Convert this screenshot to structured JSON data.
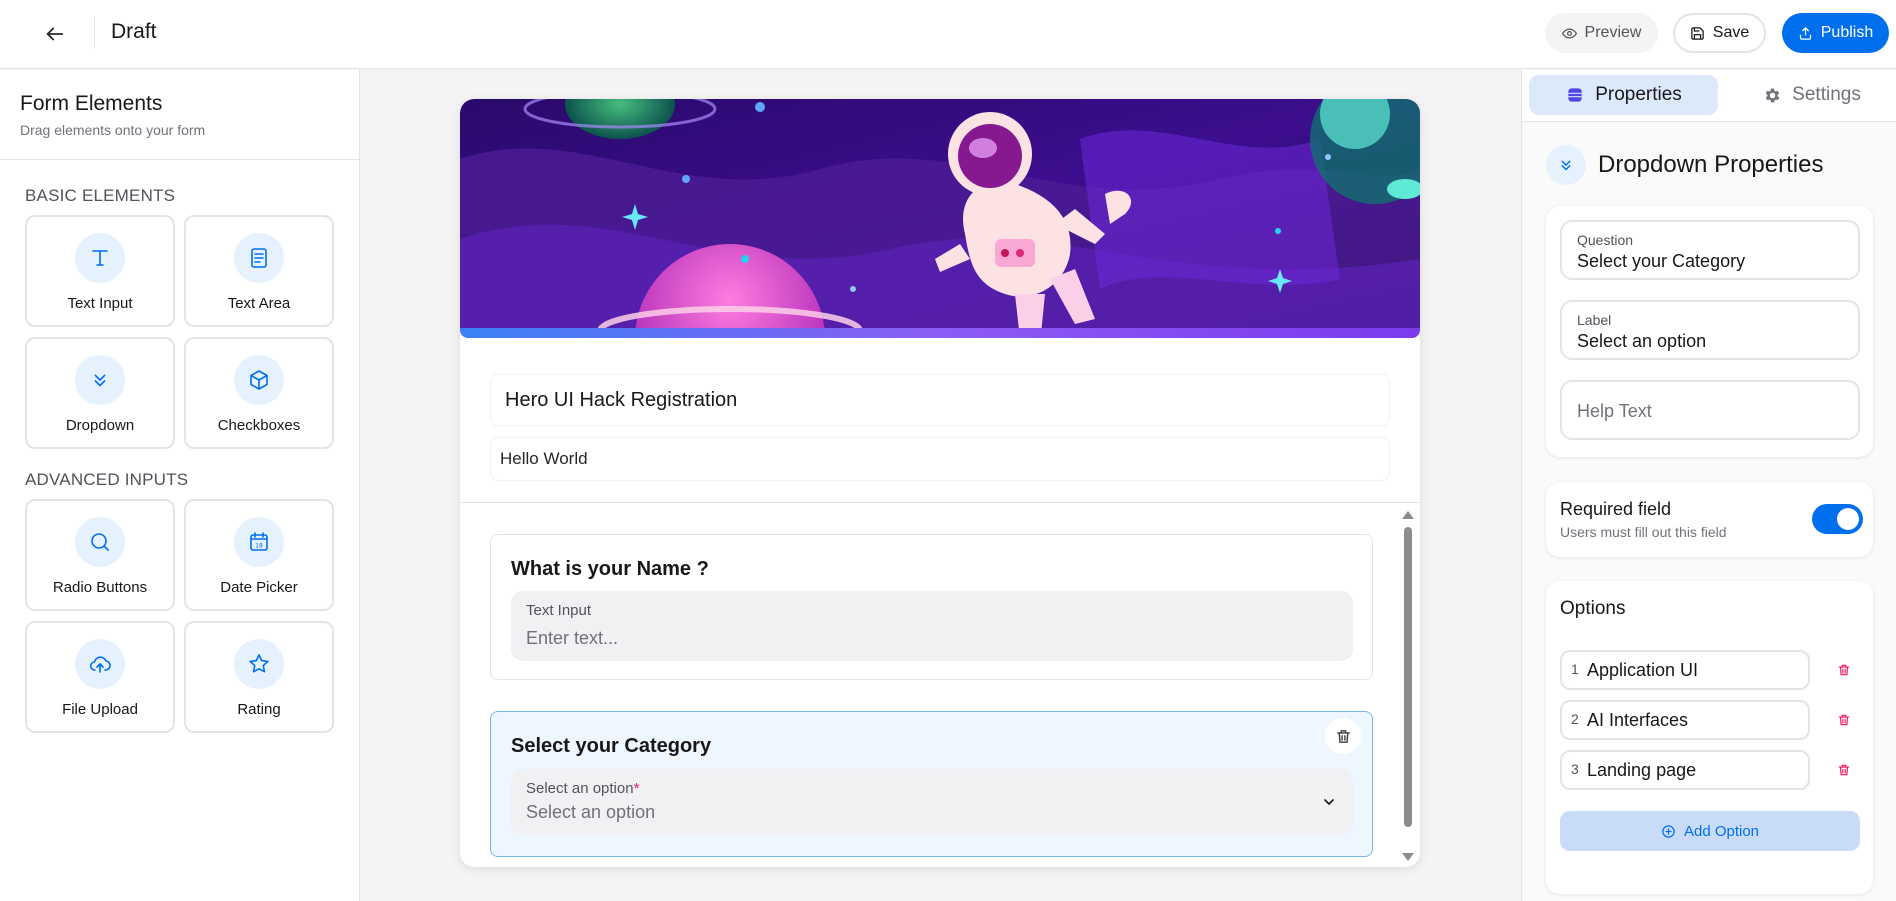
{
  "header": {
    "title": "Draft",
    "preview_label": "Preview",
    "save_label": "Save",
    "publish_label": "Publish"
  },
  "sidebar": {
    "title": "Form Elements",
    "subtitle": "Drag elements onto your form",
    "basic_title": "BASIC ELEMENTS",
    "advanced_title": "ADVANCED INPUTS",
    "basic": [
      {
        "label": "Text Input",
        "icon": "text-icon"
      },
      {
        "label": "Text Area",
        "icon": "text-area-icon"
      },
      {
        "label": "Dropdown",
        "icon": "chevron-double-down-icon"
      },
      {
        "label": "Checkboxes",
        "icon": "box-icon"
      }
    ],
    "advanced": [
      {
        "label": "Radio Buttons",
        "icon": "radio-icon"
      },
      {
        "label": "Date Picker",
        "icon": "calendar-icon"
      },
      {
        "label": "File Upload",
        "icon": "cloud-upload-icon"
      },
      {
        "label": "Rating",
        "icon": "star-icon"
      }
    ]
  },
  "form": {
    "title": "Hero UI Hack Registration",
    "description": "Hello World",
    "questions": [
      {
        "title": "What is your Name ?",
        "field_label": "Text Input",
        "placeholder": "Enter text..."
      },
      {
        "title": "Select your Category",
        "field_label": "Select an option",
        "required_mark": "*",
        "placeholder": "Select an option"
      }
    ]
  },
  "panel": {
    "tabs": {
      "properties": "Properties",
      "settings": "Settings"
    },
    "heading": "Dropdown Properties",
    "question_label": "Question",
    "question_value": "Select your Category",
    "label_label": "Label",
    "label_value": "Select an option",
    "help_placeholder": "Help Text",
    "required_title": "Required field",
    "required_sub": "Users must fill out this field",
    "required_on": true,
    "options_title": "Options",
    "options": [
      {
        "num": "1",
        "text": "Application UI"
      },
      {
        "num": "2",
        "text": "AI Interfaces"
      },
      {
        "num": "3",
        "text": "Landing page"
      }
    ],
    "add_option_label": "Add Option"
  },
  "colors": {
    "accent": "#006fee",
    "danger": "#f31260",
    "selected_card_bg": "#eef6ff"
  }
}
